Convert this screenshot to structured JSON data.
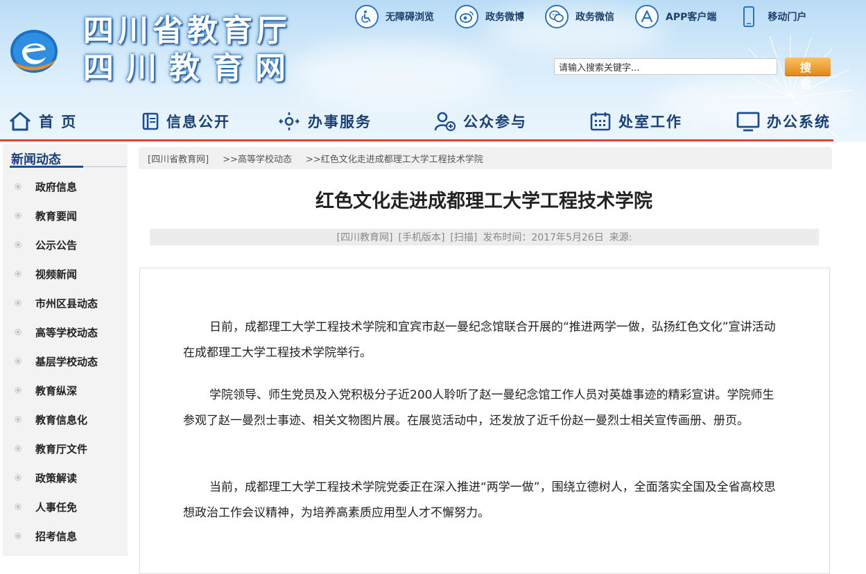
{
  "header": {
    "site_title_line1": "四川省教育厅",
    "site_title_line2": "四川教育网",
    "top_links": [
      {
        "label": "无障碍浏览",
        "icon": "accessibility-icon"
      },
      {
        "label": "政务微博",
        "icon": "weibo-icon"
      },
      {
        "label": "政务微信",
        "icon": "wechat-icon"
      },
      {
        "label": "APP客户端",
        "icon": "app-store-icon"
      },
      {
        "label": "移动门户",
        "icon": "mobile-phone-icon"
      }
    ],
    "search": {
      "placeholder": "请输入搜索关键字...",
      "button_label": "搜 索"
    }
  },
  "nav": [
    {
      "label": "首 页",
      "icon": "home-icon"
    },
    {
      "label": "信息公开",
      "icon": "book-icon"
    },
    {
      "label": "办事服务",
      "icon": "service-icon"
    },
    {
      "label": "公众参与",
      "icon": "user-add-icon"
    },
    {
      "label": "处室工作",
      "icon": "calendar-icon"
    },
    {
      "label": "办公系统",
      "icon": "monitor-icon"
    }
  ],
  "sidebar": {
    "heading": "新闻动态",
    "items": [
      "政府信息",
      "教育要闻",
      "公示公告",
      "视频新闻",
      "市州区县动态",
      "高等学校动态",
      "基层学校动态",
      "教育纵深",
      "教育信息化",
      "教育厅文件",
      "政策解读",
      "人事任免",
      "招考信息"
    ]
  },
  "breadcrumb": [
    "[四川省教育网]",
    ">>高等学校动态",
    ">>红色文化走进成都理工大学工程技术学院"
  ],
  "article": {
    "title": "红色文化走进成都理工大学工程技术学院",
    "meta": [
      "[四川教育网]",
      "[手机版本]",
      "[扫描]",
      "发布时间：2017年5月26日",
      "来源:"
    ],
    "paragraphs": [
      "日前，成都理工大学工程技术学院和宜宾市赵一曼纪念馆联合开展的“推进两学一做，弘扬红色文化”宣讲活动在成都理工大学工程技术学院举行。",
      "学院领导、师生党员及入党积极分子近200人聆听了赵一曼纪念馆工作人员对英雄事迹的精彩宣讲。学院师生参观了赵一曼烈士事迹、相关文物图片展。在展览活动中，还发放了近千份赵一曼烈士相关宣传画册、册页。",
      "当前，成都理工大学工程技术学院党委正在深入推进“两学一做”，围绕立德树人，全面落实全国及全省高校思想政治工作会议精神，为培养高素质应用型人才不懈努力。"
    ]
  },
  "colors": {
    "accent_red": "#e24040",
    "nav_text": "#1a3f73",
    "search_button": "#e38512"
  }
}
